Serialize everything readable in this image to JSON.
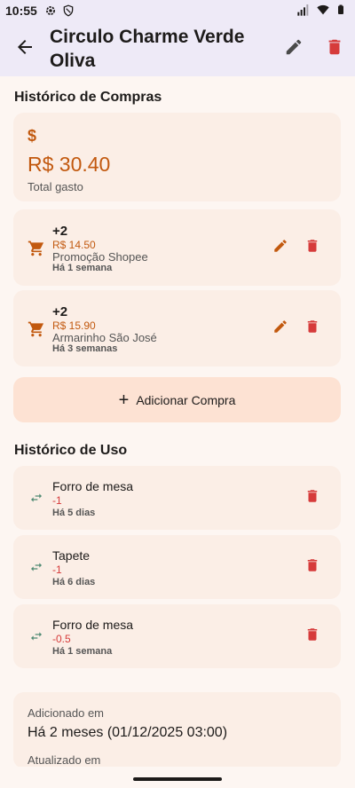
{
  "status_bar": {
    "time": "10:55"
  },
  "app_bar": {
    "title": "Circulo Charme Verde Oliva"
  },
  "purchases": {
    "section_title": "Histórico de Compras",
    "total_label": "Total gasto",
    "total_value": "R$ 30.40",
    "currency_symbol": "$",
    "items": [
      {
        "qty": "+2",
        "price": "R$ 14.50",
        "store": "Promoção Shopee",
        "when": "Há 1 semana"
      },
      {
        "qty": "+2",
        "price": "R$ 15.90",
        "store": "Armarinho São José",
        "when": "Há 3 semanas"
      }
    ],
    "add_label": "Adicionar Compra"
  },
  "usage": {
    "section_title": "Histórico de Uso",
    "items": [
      {
        "name": "Forro de mesa",
        "delta": "-1",
        "when": "Há 5 dias"
      },
      {
        "name": "Tapete",
        "delta": "-1",
        "when": "Há 6 dias"
      },
      {
        "name": "Forro de mesa",
        "delta": "-0.5",
        "when": "Há 1 semana"
      }
    ]
  },
  "info": {
    "added_label": "Adicionado em",
    "added_value": "Há 2 meses (01/12/2025 03:00)",
    "updated_label": "Atualizado em"
  },
  "colors": {
    "accent": "#c2590f",
    "danger": "#d63b3b",
    "card_bg": "#fbeee6",
    "appbar_bg": "#eeeaf7"
  },
  "icons": [
    "back-arrow-icon",
    "edit-icon",
    "delete-icon",
    "dollar-icon",
    "cart-icon",
    "swap-icon",
    "plus-icon"
  ]
}
